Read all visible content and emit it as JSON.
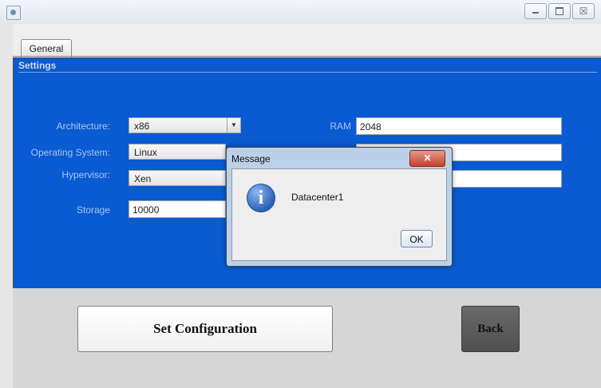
{
  "window": {
    "icon": "java-app-icon",
    "controls": {
      "close_label": "☒"
    }
  },
  "tabs": [
    {
      "label": "General"
    }
  ],
  "settings": {
    "title": "Settings",
    "fields": {
      "architecture": {
        "label": "Architecture:",
        "value": "x86"
      },
      "operating_system": {
        "label": "Operating System:",
        "value": "Linux"
      },
      "hypervisor": {
        "label": "Hypervisor:",
        "value": "Xen"
      },
      "storage": {
        "label": "Storage",
        "value": "10000"
      },
      "ram": {
        "label": "RAM",
        "value": "2048"
      }
    }
  },
  "buttons": {
    "set_configuration": "Set Configuration",
    "back": "Back"
  },
  "dialog": {
    "title": "Message",
    "close_label": "✕",
    "icon": "info-icon",
    "icon_glyph": "i",
    "message": "Datacenter1",
    "ok_label": "OK"
  },
  "colors": {
    "panel_blue": "#0a5ad1",
    "label_text": "#a7c4f2",
    "back_button": "#5a5a5a"
  }
}
